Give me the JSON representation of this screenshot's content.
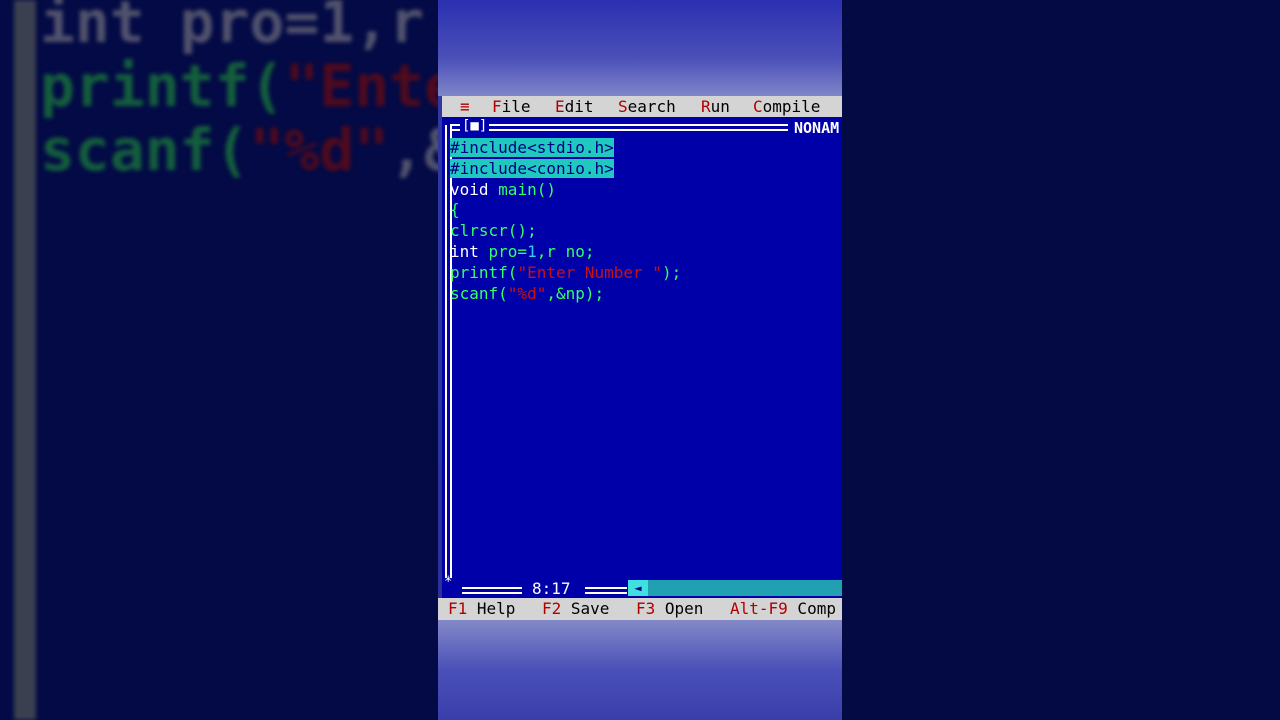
{
  "menu": {
    "system_icon": "≡",
    "items": [
      {
        "hot": "F",
        "rest": "ile"
      },
      {
        "hot": "E",
        "rest": "dit"
      },
      {
        "hot": "S",
        "rest": "earch"
      },
      {
        "hot": "R",
        "rest": "un"
      },
      {
        "hot": "C",
        "rest": "ompile"
      }
    ]
  },
  "window": {
    "close_box": "[■]",
    "filename": "NONAM"
  },
  "code": {
    "line1": "#include<stdio.h>",
    "line2": "#include<conio.h>",
    "line3_kw": "void ",
    "line3_fn": "main()",
    "line4": "{",
    "line5": "clrscr();",
    "line6_kw": "int ",
    "line6_a": "pro=",
    "line6_num": "1",
    "line6_b": ",r no;",
    "line7_fn": "printf(",
    "line7_str": "\"Enter Number \"",
    "line7_end": ");",
    "line8_fn": "scanf(",
    "line8_str": "\"%d\"",
    "line8_end": ",&np);"
  },
  "status": {
    "position": "8:17"
  },
  "hints": [
    {
      "key": "F1",
      "label": " Help"
    },
    {
      "key": "F2",
      "label": " Save"
    },
    {
      "key": "F3",
      "label": " Open"
    },
    {
      "key": "Alt-F9",
      "label": " Comp"
    }
  ],
  "background_code": {
    "line1": "int pro=1,r",
    "line2_a": "printf(",
    "line2_b": "\"Ente",
    "line3_a": "scanf(",
    "line3_b": "\"%d\"",
    "line3_c": ",&"
  }
}
